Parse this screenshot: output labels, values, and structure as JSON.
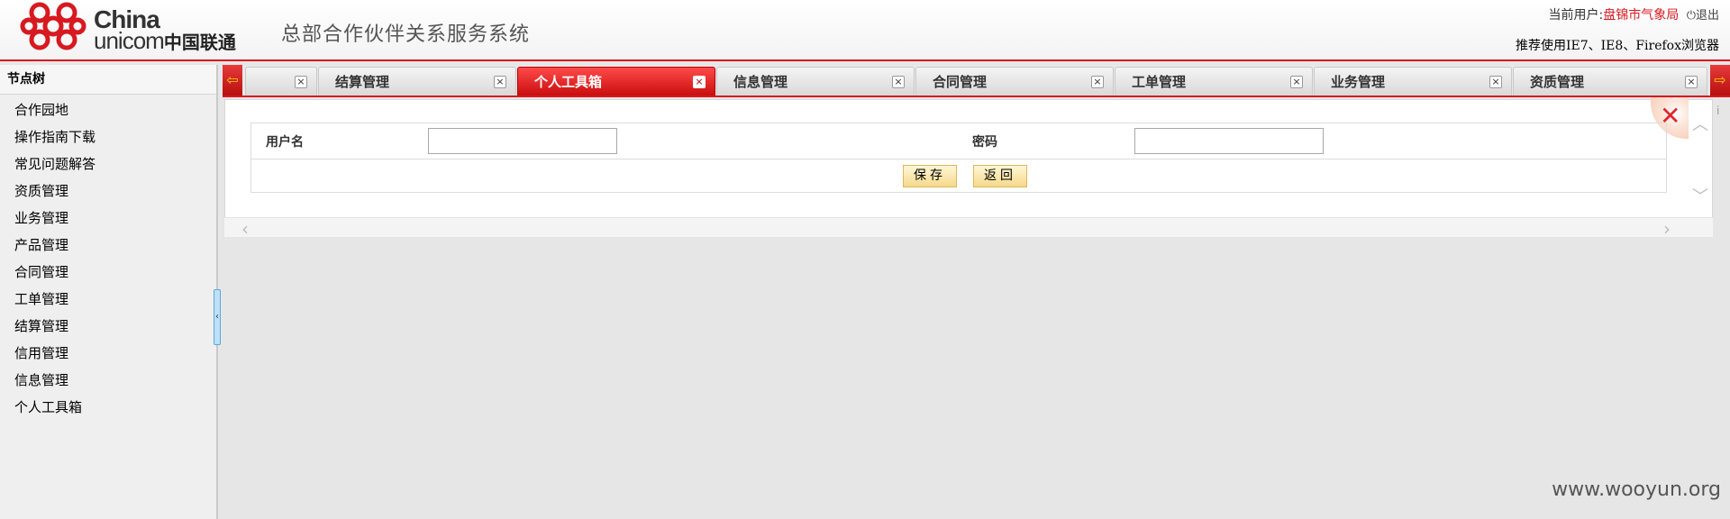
{
  "header": {
    "logo_line1": "China",
    "logo_line2_en": "unicom",
    "logo_line2_cn": "中国联通",
    "system_title": "总部合作伙伴关系服务系统",
    "current_user_label": "当前用户:",
    "current_user_name": "盘锦市气象局",
    "logout_label": "退出",
    "browser_tip": "推荐使用IE7、IE8、Firefox浏览器",
    "brand_color": "#d71920"
  },
  "sidebar": {
    "title": "节点树",
    "items": [
      {
        "label": "合作园地"
      },
      {
        "label": "操作指南下载"
      },
      {
        "label": "常见问题解答"
      },
      {
        "label": "资质管理"
      },
      {
        "label": "业务管理"
      },
      {
        "label": "产品管理"
      },
      {
        "label": "合同管理"
      },
      {
        "label": "工单管理"
      },
      {
        "label": "结算管理"
      },
      {
        "label": "信用管理"
      },
      {
        "label": "信息管理"
      },
      {
        "label": "个人工具箱"
      }
    ]
  },
  "tabs": {
    "items": [
      {
        "label": "",
        "active": false
      },
      {
        "label": "结算管理",
        "active": false
      },
      {
        "label": "个人工具箱",
        "active": true
      },
      {
        "label": "信息管理",
        "active": false
      },
      {
        "label": "合同管理",
        "active": false
      },
      {
        "label": "工单管理",
        "active": false
      },
      {
        "label": "业务管理",
        "active": false
      },
      {
        "label": "资质管理",
        "active": false
      }
    ],
    "close_glyph": "×"
  },
  "form": {
    "username_label": "用户名",
    "username_value": "",
    "password_label": "密码",
    "password_value": "",
    "save_label": "保存",
    "back_label": "返回"
  },
  "watermark": "www.wooyun.org"
}
